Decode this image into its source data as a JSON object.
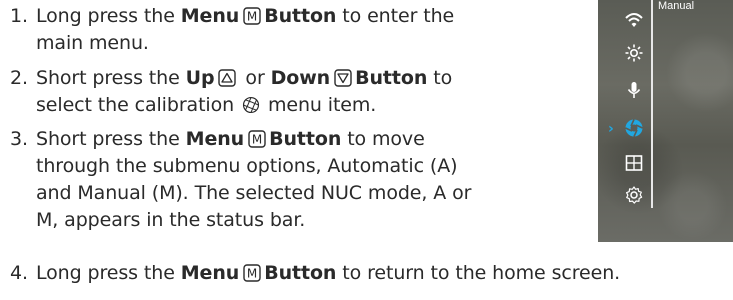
{
  "steps": [
    {
      "number": "1.",
      "pre": "Long press the ",
      "key1_label": "Menu",
      "key1_letter": "M",
      "key1_suffix": "Button",
      "post": " to enter the",
      "line2": "main menu."
    },
    {
      "number": "2.",
      "pre": "Short press the ",
      "key1_label": "Up",
      "mid": " or ",
      "key2_label": "Down",
      "key2_suffix": "Button",
      "post": " to",
      "line2_pre": "select the calibration ",
      "line2_post": " menu item."
    },
    {
      "number": "3.",
      "pre": "Short press the ",
      "key1_label": "Menu",
      "key1_letter": "M",
      "key1_suffix": "Button",
      "post": " to move",
      "line2": "through the submenu options, Automatic (A)",
      "line3": "and Manual (M). The selected NUC mode, A or",
      "line4": "M, appears in the status bar."
    },
    {
      "number": "4.",
      "pre": "Long press the ",
      "key1_label": "Menu",
      "key1_letter": "M",
      "key1_suffix": "Button",
      "post": " to return to the home screen."
    }
  ],
  "device": {
    "status_label": "Manual",
    "cursor": "›",
    "icons": [
      "wifi-icon",
      "sun-icon",
      "microphone-icon",
      "calibration-icon",
      "grid-icon",
      "settings-gear-icon"
    ],
    "selected_icon": "calibration-icon",
    "accent_color": "#21a7e0"
  }
}
